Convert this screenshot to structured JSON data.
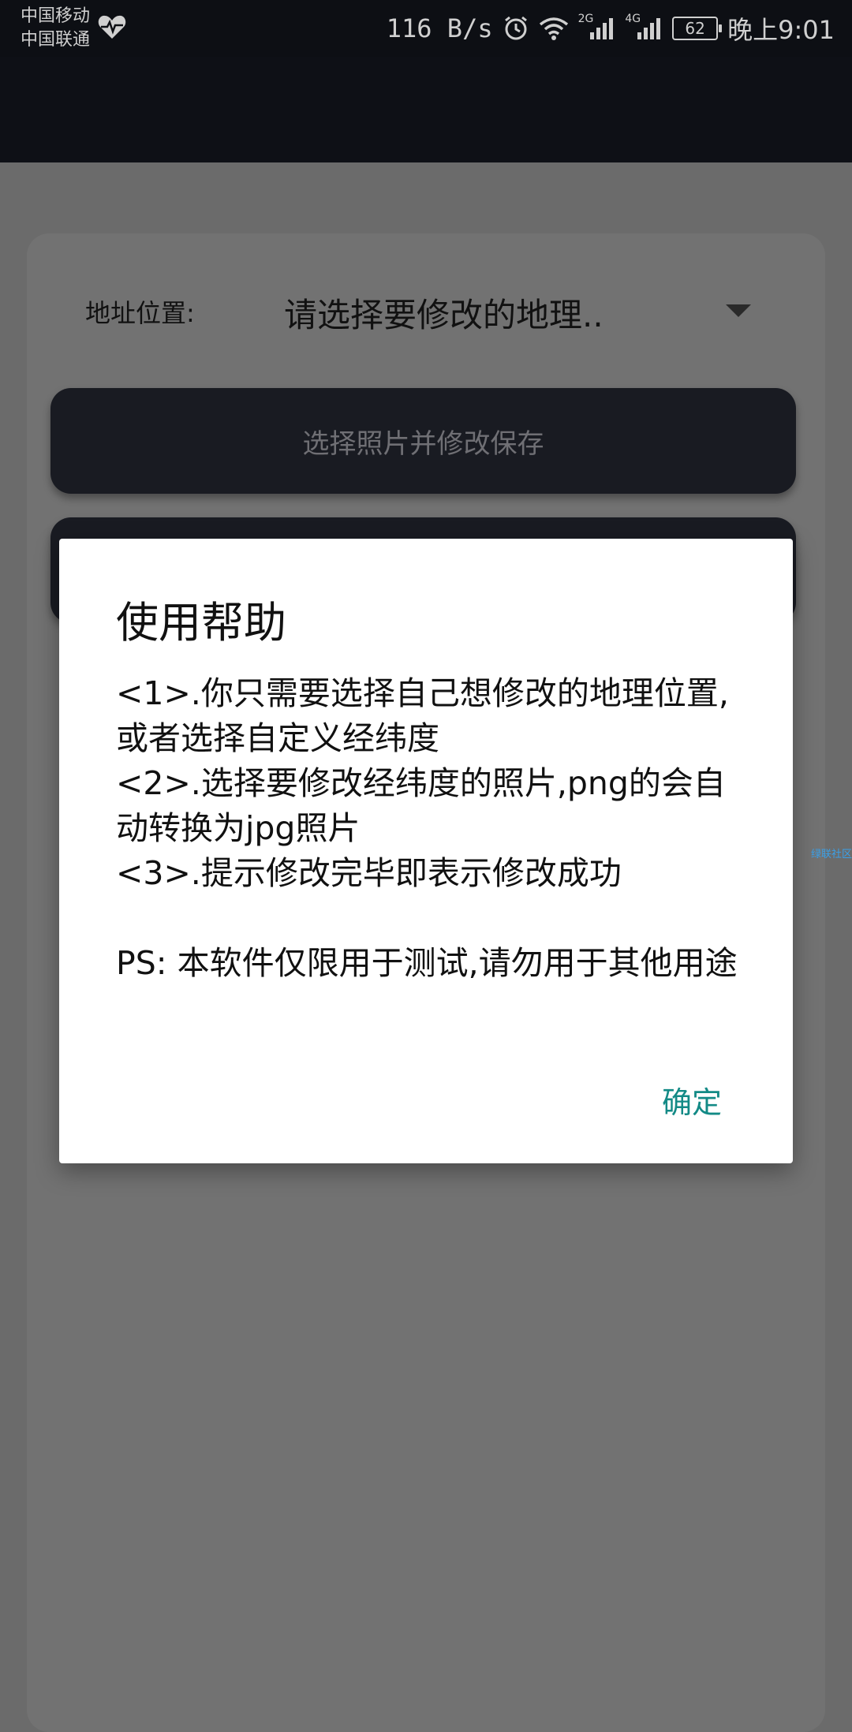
{
  "status_bar": {
    "carrier_1": "中国移动",
    "carrier_2": "中国联通",
    "net_speed": "116 B/s",
    "net_2g": "2G",
    "net_4g": "4G",
    "battery": "62",
    "time": "晚上9:01"
  },
  "form": {
    "address_label": "地址位置:",
    "address_select": "请选择要修改的地理..",
    "select_photo_button": "选择照片并修改保存"
  },
  "watermark": "绿联社区",
  "dialog": {
    "title": "使用帮助",
    "lines": [
      "<1>.你只需要选择自己想修改的地理位置,或者选择自定义经纬度",
      "<2>.选择要修改经纬度的照片,png的会自动转换为jpg照片",
      "<3>.提示修改完毕即表示修改成功",
      "PS: 本软件仅限用于测试,请勿用于其他用途"
    ],
    "confirm": "确定"
  },
  "colors": {
    "accent": "#138a86",
    "dark_bar": "#0e1016",
    "scrim": "#6b6b6b"
  }
}
